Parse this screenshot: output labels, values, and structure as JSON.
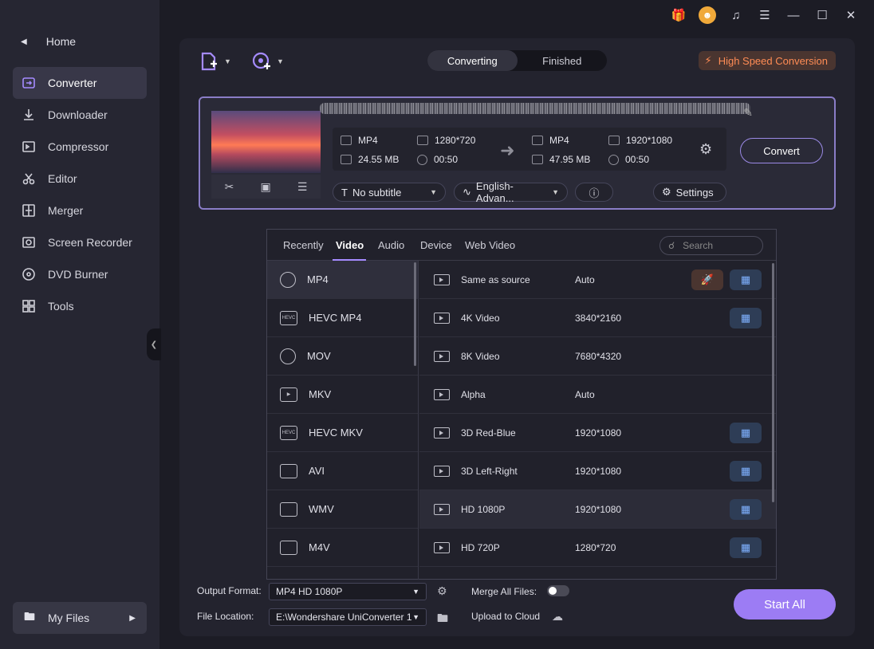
{
  "sidebar": {
    "home": "Home",
    "items": [
      {
        "label": "Converter",
        "icon": "converter-icon",
        "active": true
      },
      {
        "label": "Downloader",
        "icon": "downloader-icon"
      },
      {
        "label": "Compressor",
        "icon": "compressor-icon"
      },
      {
        "label": "Editor",
        "icon": "scissors-icon"
      },
      {
        "label": "Merger",
        "icon": "merger-icon"
      },
      {
        "label": "Screen Recorder",
        "icon": "screen-recorder-icon"
      },
      {
        "label": "DVD Burner",
        "icon": "dvd-icon"
      },
      {
        "label": "Tools",
        "icon": "tools-icon"
      }
    ],
    "my_files": "My Files"
  },
  "header": {
    "tabs": [
      {
        "label": "Converting",
        "active": true
      },
      {
        "label": "Finished"
      }
    ],
    "high_speed": "High Speed Conversion"
  },
  "file": {
    "source": {
      "format": "MP4",
      "resolution": "1280*720",
      "size": "24.55 MB",
      "duration": "00:50"
    },
    "target": {
      "format": "MP4",
      "resolution": "1920*1080",
      "size": "47.95 MB",
      "duration": "00:50"
    },
    "convert_label": "Convert",
    "subtitle": "No subtitle",
    "audio": "English-Advan...",
    "settings": "Settings"
  },
  "format_popup": {
    "tabs": [
      "Recently",
      "Video",
      "Audio",
      "Device",
      "Web Video"
    ],
    "active_tab": "Video",
    "search_placeholder": "Search",
    "formats": [
      "MP4",
      "HEVC MP4",
      "MOV",
      "MKV",
      "HEVC MKV",
      "AVI",
      "WMV",
      "M4V"
    ],
    "presets": [
      {
        "name": "Same as source",
        "res": "Auto",
        "accel": true,
        "rocket": true
      },
      {
        "name": "4K Video",
        "res": "3840*2160",
        "accel": true
      },
      {
        "name": "8K Video",
        "res": "7680*4320",
        "accel": false
      },
      {
        "name": "Alpha",
        "res": "Auto",
        "accel": false
      },
      {
        "name": "3D Red-Blue",
        "res": "1920*1080",
        "accel": true
      },
      {
        "name": "3D Left-Right",
        "res": "1920*1080",
        "accel": true
      },
      {
        "name": "HD 1080P",
        "res": "1920*1080",
        "accel": true,
        "selected": true
      },
      {
        "name": "HD 720P",
        "res": "1280*720",
        "accel": true
      }
    ]
  },
  "bottom": {
    "output_format_label": "Output Format:",
    "output_format_value": "MP4 HD 1080P",
    "merge_label": "Merge All Files:",
    "file_location_label": "File Location:",
    "file_location_value": "E:\\Wondershare UniConverter 1",
    "upload_label": "Upload to Cloud",
    "start_all": "Start All"
  },
  "colors": {
    "accent": "#9c7cf4",
    "orange": "#ff8c55",
    "accel_blue": "#7fb1ff"
  }
}
